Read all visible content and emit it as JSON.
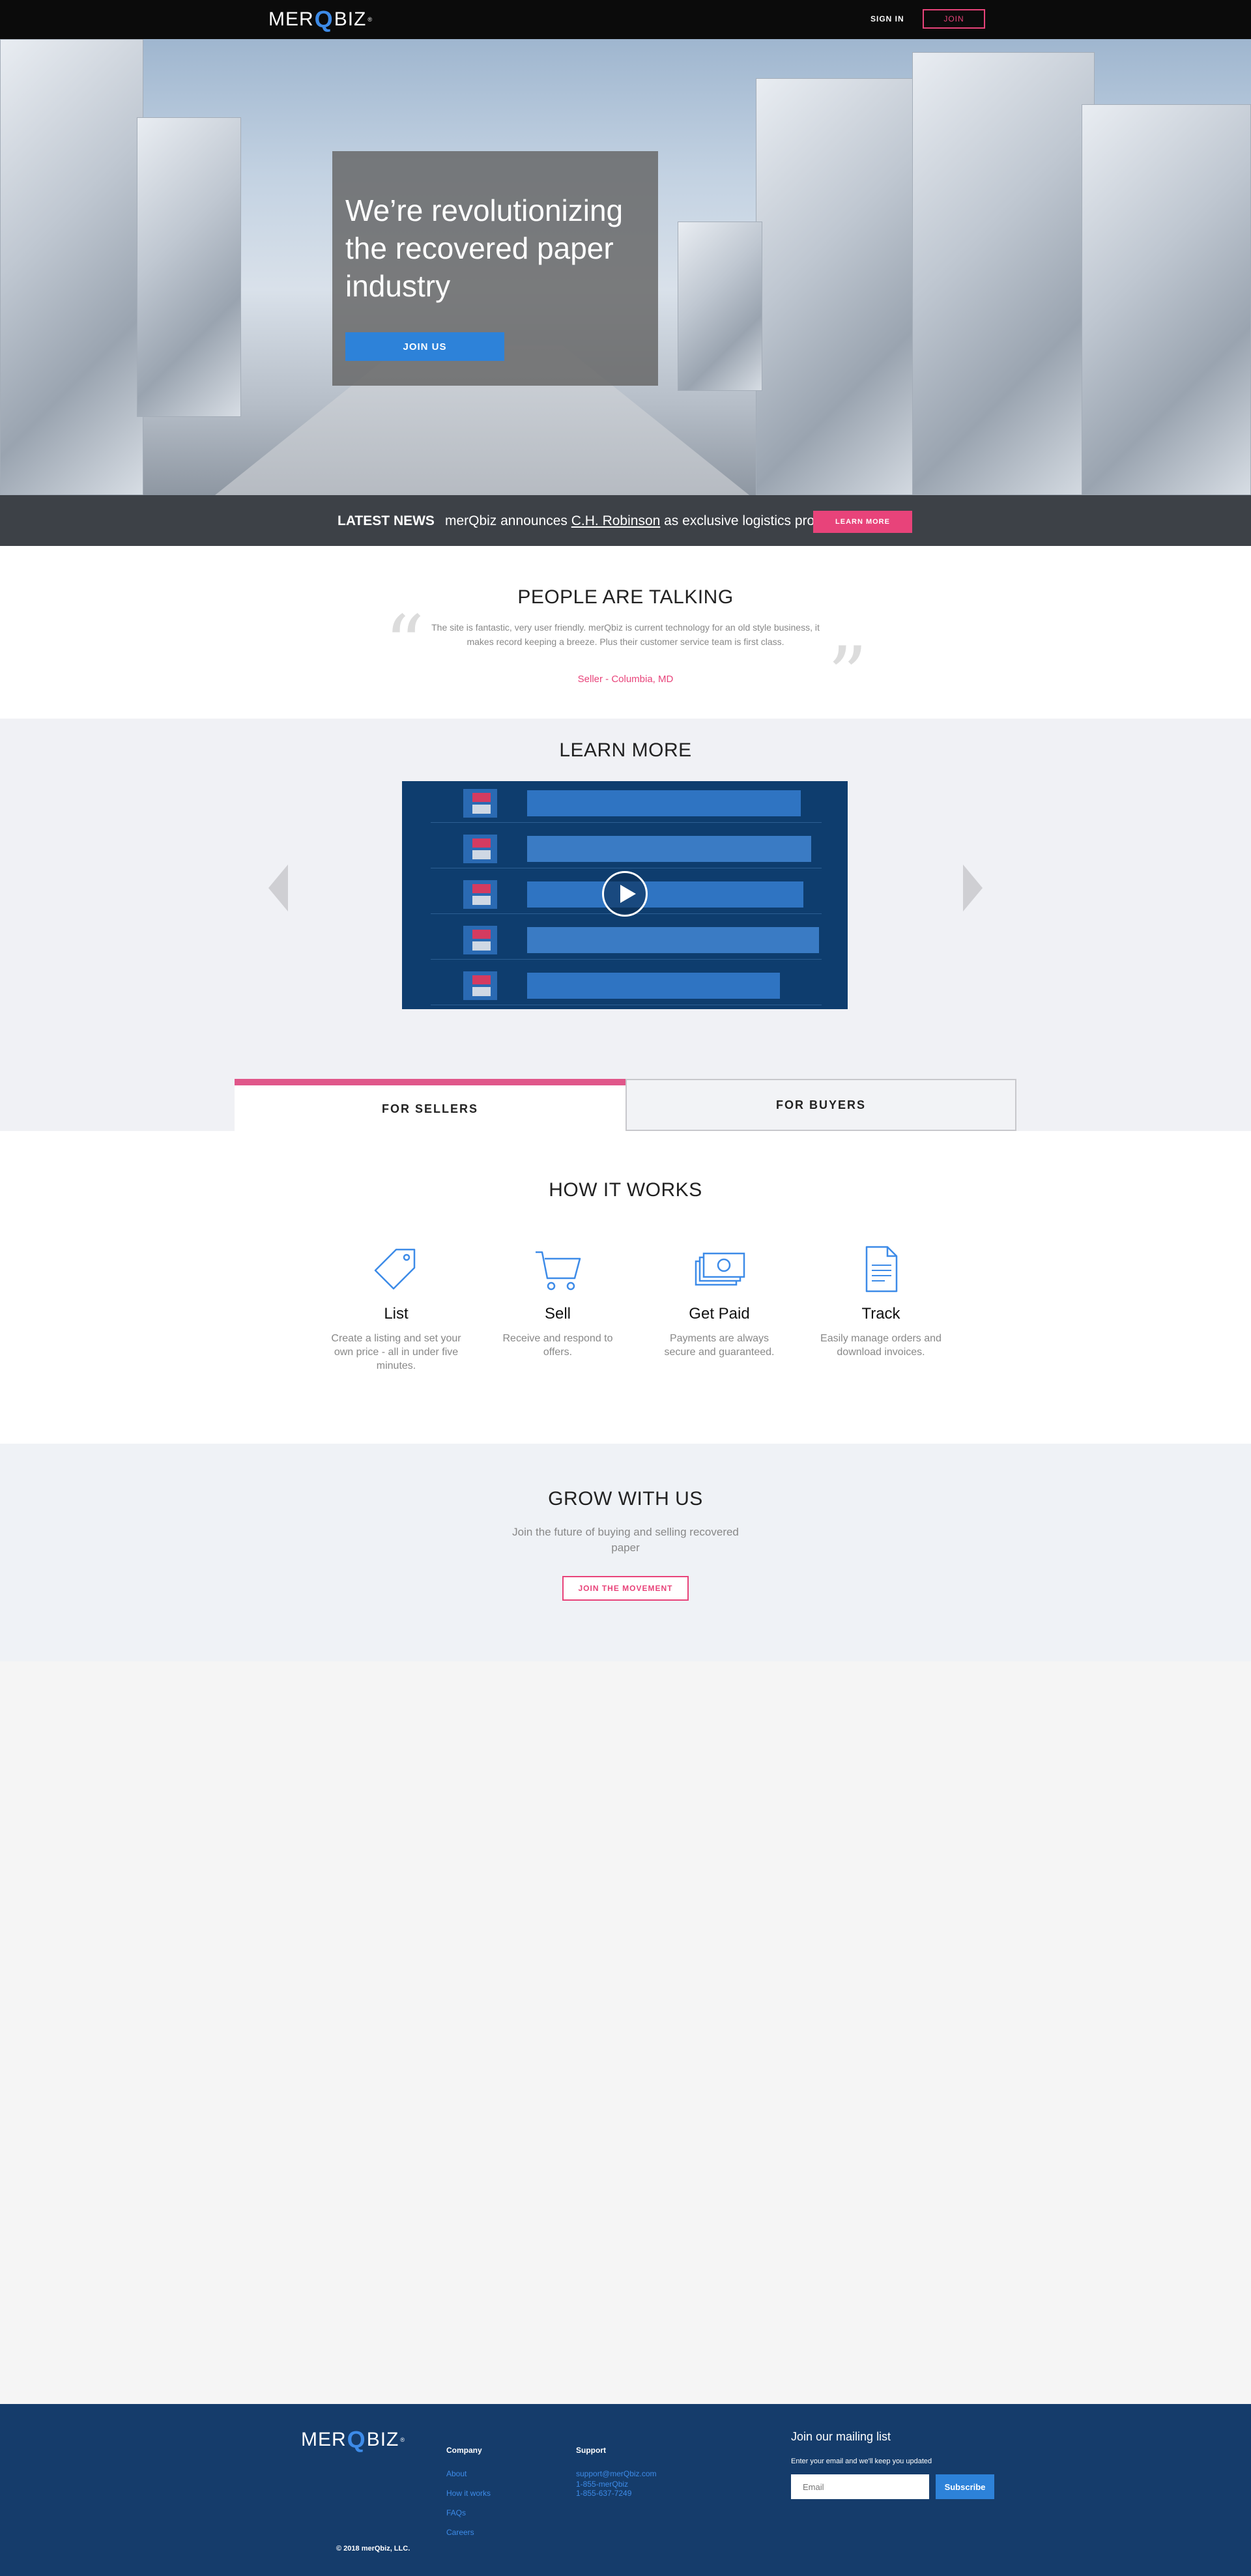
{
  "brand": {
    "logo_pre": "MER",
    "logo_q": "Q",
    "logo_post": "BIZ",
    "logo_tm": "®",
    "accent": "#e8437a",
    "primary": "#2d82d9",
    "footer_bg": "#153c6b"
  },
  "nav": {
    "sign_in": "SIGN IN",
    "join": "JOIN"
  },
  "hero": {
    "title": "We’re revolutionizing the recovered paper industry",
    "join_button": "JOIN US"
  },
  "news": {
    "label": "LATEST NEWS",
    "text_before": "merQbiz announces ",
    "link": "C.H. Robinson",
    "text_after": " as exclusive logistics provider",
    "button": "LEARN MORE"
  },
  "testimonials": {
    "title": "PEOPLE ARE TALKING",
    "quote": "The site is fantastic, very user friendly. merQbiz is current technology for an old style business, it makes record keeping a breeze. Plus their customer service team is first class.",
    "author": "Seller - Columbia, MD",
    "open_mark": "“",
    "close_mark": "”"
  },
  "learn_more": {
    "title": "LEARN MORE",
    "video_icon": "play-icon"
  },
  "tabs": {
    "sellers": "FOR SELLERS",
    "buyers": "FOR BUYERS",
    "active": "sellers"
  },
  "how_it_works": {
    "title": "HOW IT WORKS",
    "steps": [
      {
        "title": "List",
        "desc": "Create a listing and set your own price - all in under five minutes.",
        "icon": "price-tag-icon"
      },
      {
        "title": "Sell",
        "desc": "Receive and respond to offers.",
        "icon": "cart-icon"
      },
      {
        "title": "Get Paid",
        "desc": "Payments are always secure and guaranteed.",
        "icon": "cash-icon"
      },
      {
        "title": "Track",
        "desc": "Easily manage orders and download invoices.",
        "icon": "invoice-icon"
      }
    ]
  },
  "grow": {
    "title": "GROW WITH US",
    "subtitle": "Join the future of buying and selling recovered paper",
    "button": "JOIN THE MOVEMENT"
  },
  "footer": {
    "company_title": "Company",
    "company_links": [
      "About",
      "How it works",
      "FAQs",
      "Careers"
    ],
    "support_title": "Support",
    "support_email": "support@merQbiz.com",
    "support_phone1": "1-855-merQbiz",
    "support_phone2": "1-855-637-7249",
    "mailing_title": "Join our mailing list",
    "mailing_sub": "Enter your email and we'll keep you updated",
    "email_placeholder": "Email",
    "subscribe": "Subscribe",
    "copyright": "© 2018 merQbiz, LLC."
  }
}
